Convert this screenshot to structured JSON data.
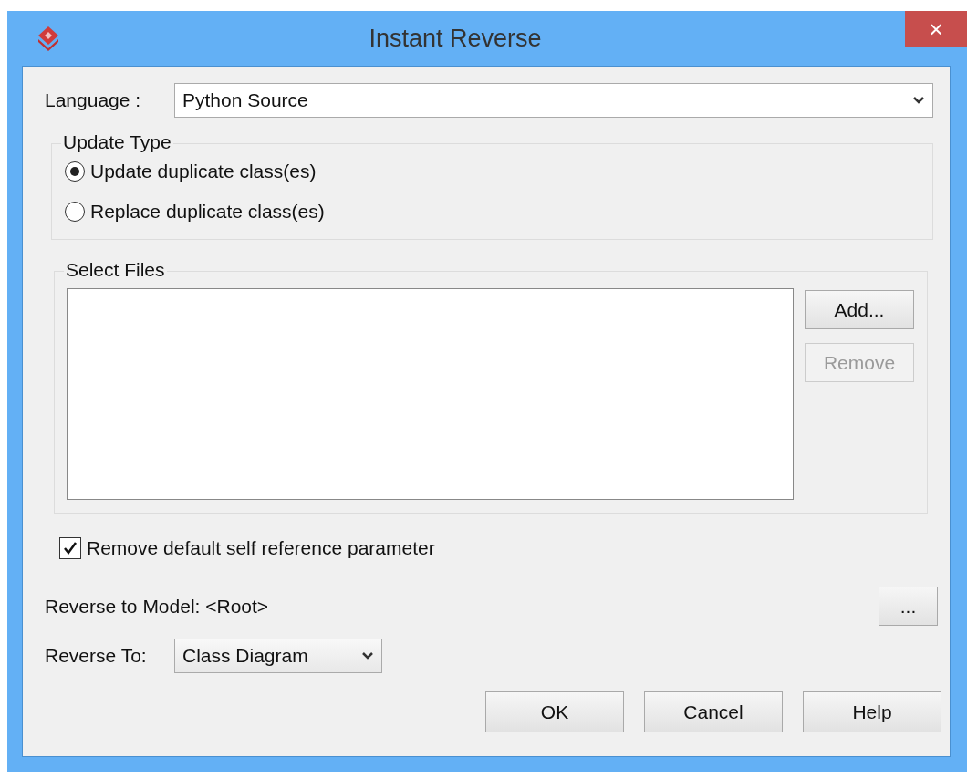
{
  "window": {
    "title": "Instant Reverse",
    "close": "×"
  },
  "language": {
    "label": "Language :",
    "value": "Python Source"
  },
  "update_type": {
    "title": "Update Type",
    "options": [
      {
        "label": "Update duplicate class(es)",
        "selected": true
      },
      {
        "label": "Replace duplicate class(es)",
        "selected": false
      }
    ]
  },
  "select_files": {
    "title": "Select Files",
    "buttons": [
      {
        "label": "Add...",
        "disabled": false
      },
      {
        "label": "Remove",
        "disabled": true
      }
    ]
  },
  "self_reference": {
    "label": "Remove default self reference parameter",
    "checked": true
  },
  "reverse_to_model": {
    "label": "Reverse to Model: <Root>",
    "browse": "..."
  },
  "reverse_to": {
    "label": "Reverse To:",
    "value": "Class Diagram"
  },
  "buttons": [
    "OK",
    "Cancel",
    "Help"
  ]
}
